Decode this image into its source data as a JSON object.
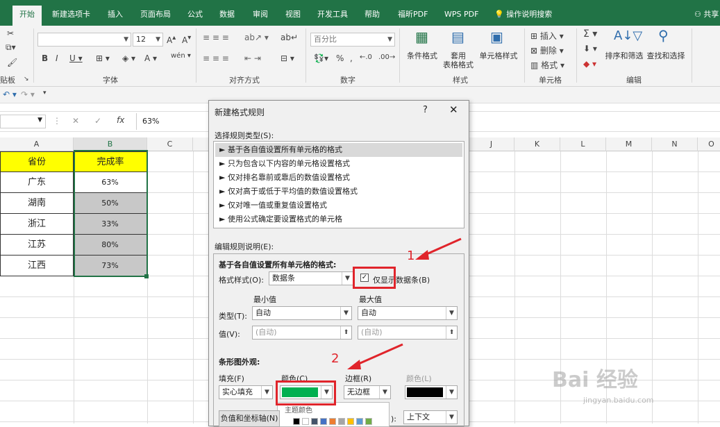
{
  "ribbon_tabs": [
    "开始",
    "新建选项卡",
    "插入",
    "页面布局",
    "公式",
    "数据",
    "审阅",
    "视图",
    "开发工具",
    "帮助",
    "福昕PDF",
    "WPS PDF",
    "操作说明搜索"
  ],
  "share_label": "共享",
  "ribbon": {
    "font_size": "12",
    "number_format": "百分比",
    "group_font": "字体",
    "group_align": "对齐方式",
    "group_number": "数字",
    "group_style": "样式",
    "group_cells": "单元格",
    "group_edit": "编辑",
    "group_clip": "贴板",
    "cond_format": "条件格式",
    "table_format": "套用\n表格格式",
    "cell_style": "单元格样式",
    "insert": "插入",
    "delete": "删除",
    "format": "格式",
    "sort_filter": "排序和筛选",
    "find_select": "查找和选择"
  },
  "formula": {
    "value": "63%"
  },
  "columns": [
    "A",
    "B",
    "C",
    "J",
    "K",
    "L",
    "M",
    "N",
    "O"
  ],
  "sheet": {
    "header": [
      "省份",
      "完成率"
    ],
    "rows": [
      [
        "广东",
        "63%"
      ],
      [
        "湖南",
        "50%"
      ],
      [
        "浙江",
        "33%"
      ],
      [
        "江苏",
        "80%"
      ],
      [
        "江西",
        "73%"
      ]
    ],
    "header_bg": "#FFFF00",
    "data_bar": "#c8c8c8"
  },
  "dialog": {
    "title": "新建格式规则",
    "help": "?",
    "select_type_label": "选择规则类型(S):",
    "rule_types": [
      "► 基于各自值设置所有单元格的格式",
      "► 只为包含以下内容的单元格设置格式",
      "► 仅对排名靠前或靠后的数值设置格式",
      "► 仅对高于或低于平均值的数值设置格式",
      "► 仅对唯一值或重复值设置格式",
      "► 使用公式确定要设置格式的单元格"
    ],
    "edit_label": "编辑规则说明(E):",
    "section_title": "基于各自值设置所有单元格的格式:",
    "style_label": "格式样式(O):",
    "style_value": "数据条",
    "show_bar_only": "仅显示数据条(B)",
    "min_label": "最小值",
    "max_label": "最大值",
    "type_label": "类型(T):",
    "type_min": "自动",
    "type_max": "自动",
    "value_label": "值(V):",
    "value_min": "(自动)",
    "value_max": "(自动)",
    "bar_look": "条形图外观:",
    "fill_label": "填充(F)",
    "color_label": "颜色(C)",
    "border_label": "边框(R)",
    "border_color_label": "颜色(L)",
    "fill_value": "实心填充",
    "border_value": "无边框",
    "fill_color": "#00b050",
    "border_color": "#000000",
    "theme_colors": "主题颜色",
    "axis_button": "负值和坐标轴(N)",
    "direction_value": "上下文",
    "direction_suffix": "):"
  },
  "annotations": {
    "one": "1",
    "two": "2"
  },
  "watermark": {
    "brand": "Bai 经验",
    "url": "jingyan.baidu.com"
  }
}
